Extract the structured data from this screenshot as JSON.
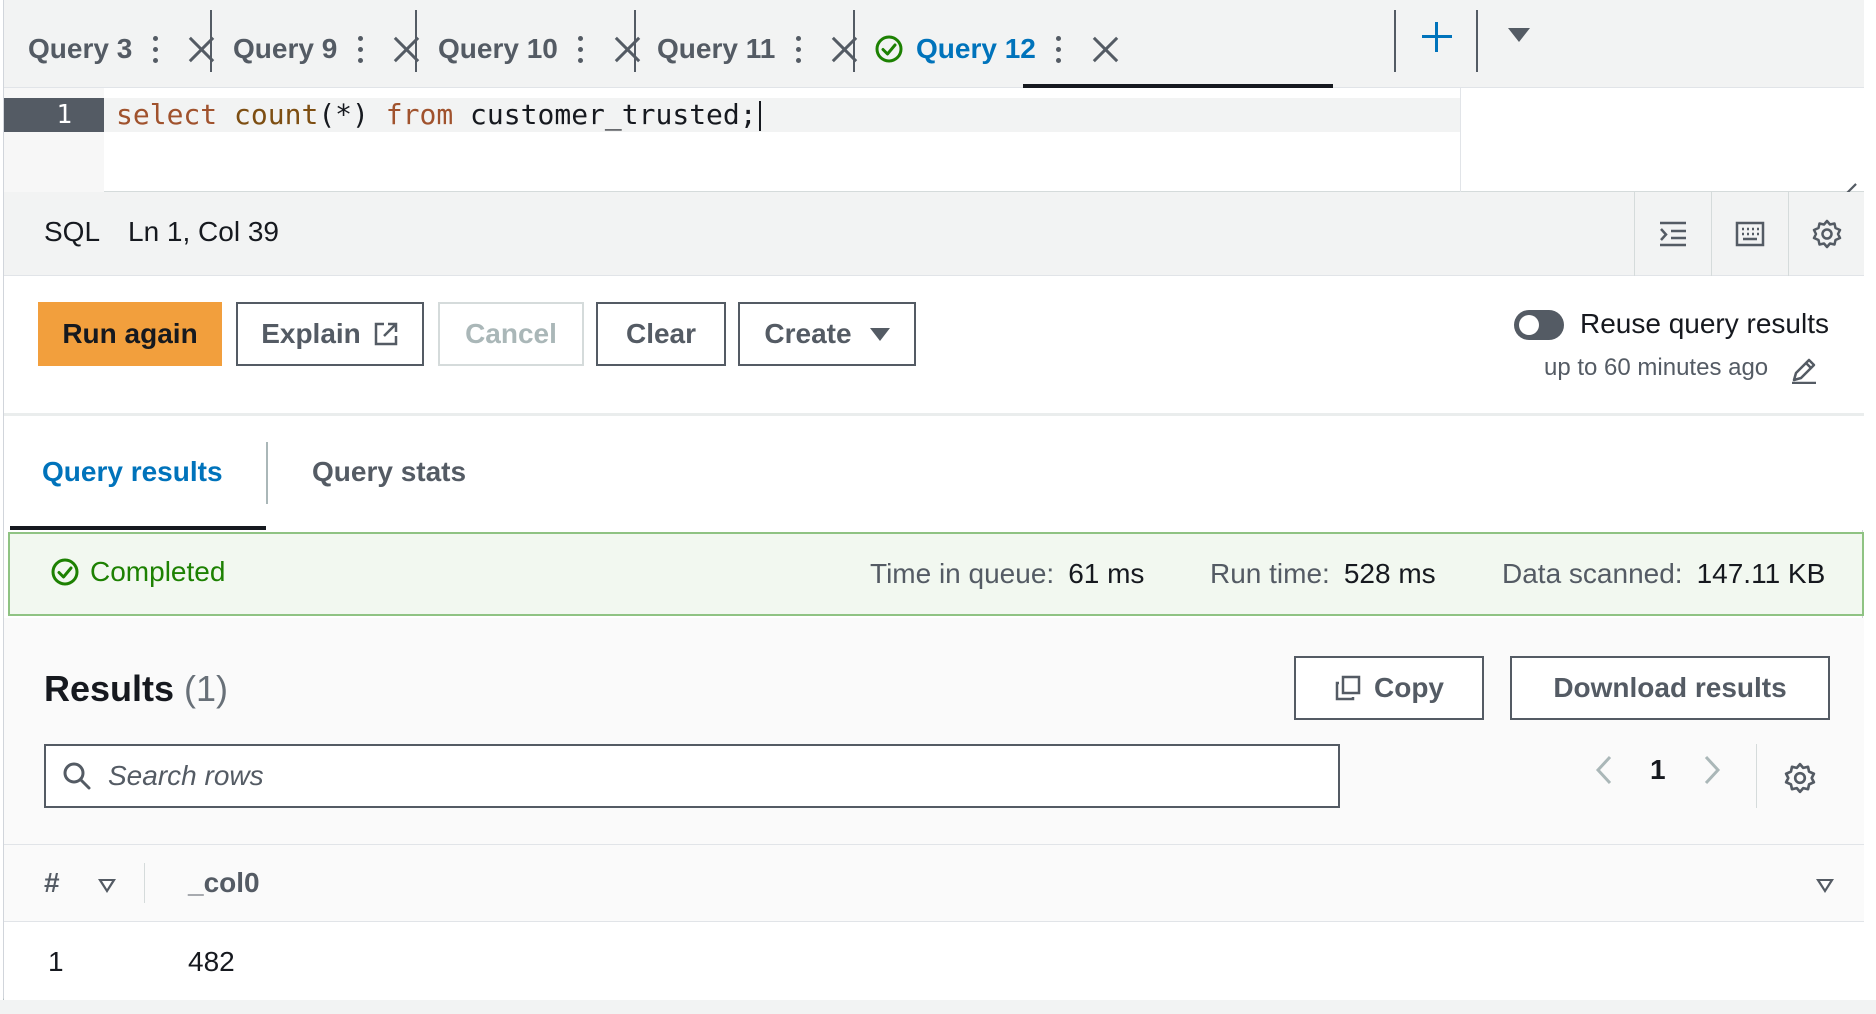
{
  "tabs": [
    {
      "label": "Query 3",
      "active": false
    },
    {
      "label": "Query 9",
      "active": false
    },
    {
      "label": "Query 10",
      "active": false
    },
    {
      "label": "Query 11",
      "active": false
    },
    {
      "label": "Query 12",
      "active": true
    }
  ],
  "editor": {
    "line_number": "1",
    "code_keyword_select": "select",
    "code_fn": "count",
    "code_args": "(*)",
    "code_keyword_from": "from",
    "code_rest": "customer_trusted;"
  },
  "statusbar": {
    "language": "SQL",
    "cursor_position": "Ln 1, Col 39",
    "icons": [
      "indent-icon",
      "keyboard-icon",
      "settings-icon"
    ]
  },
  "actions": {
    "run_again": "Run again",
    "explain": "Explain",
    "cancel": "Cancel",
    "clear": "Clear",
    "create": "Create",
    "reuse_label": "Reuse query results",
    "reuse_sub": "up to 60 minutes ago",
    "reuse_enabled": false
  },
  "result_tabs": {
    "query_results": "Query results",
    "query_stats": "Query stats"
  },
  "status": {
    "state": "Completed",
    "time_in_queue_label": "Time in queue:",
    "time_in_queue": "61 ms",
    "run_time_label": "Run time:",
    "run_time": "528 ms",
    "data_scanned_label": "Data scanned:",
    "data_scanned": "147.11 KB",
    "color": "#1d8102"
  },
  "results": {
    "title": "Results",
    "count": "(1)",
    "copy": "Copy",
    "download": "Download results",
    "search_placeholder": "Search rows",
    "page": "1",
    "columns": [
      "#",
      "_col0"
    ],
    "rows": [
      [
        "1",
        "482"
      ]
    ]
  },
  "colors": {
    "accent": "#0073bb",
    "primary_button": "#f29f3d",
    "success": "#1d8102"
  }
}
